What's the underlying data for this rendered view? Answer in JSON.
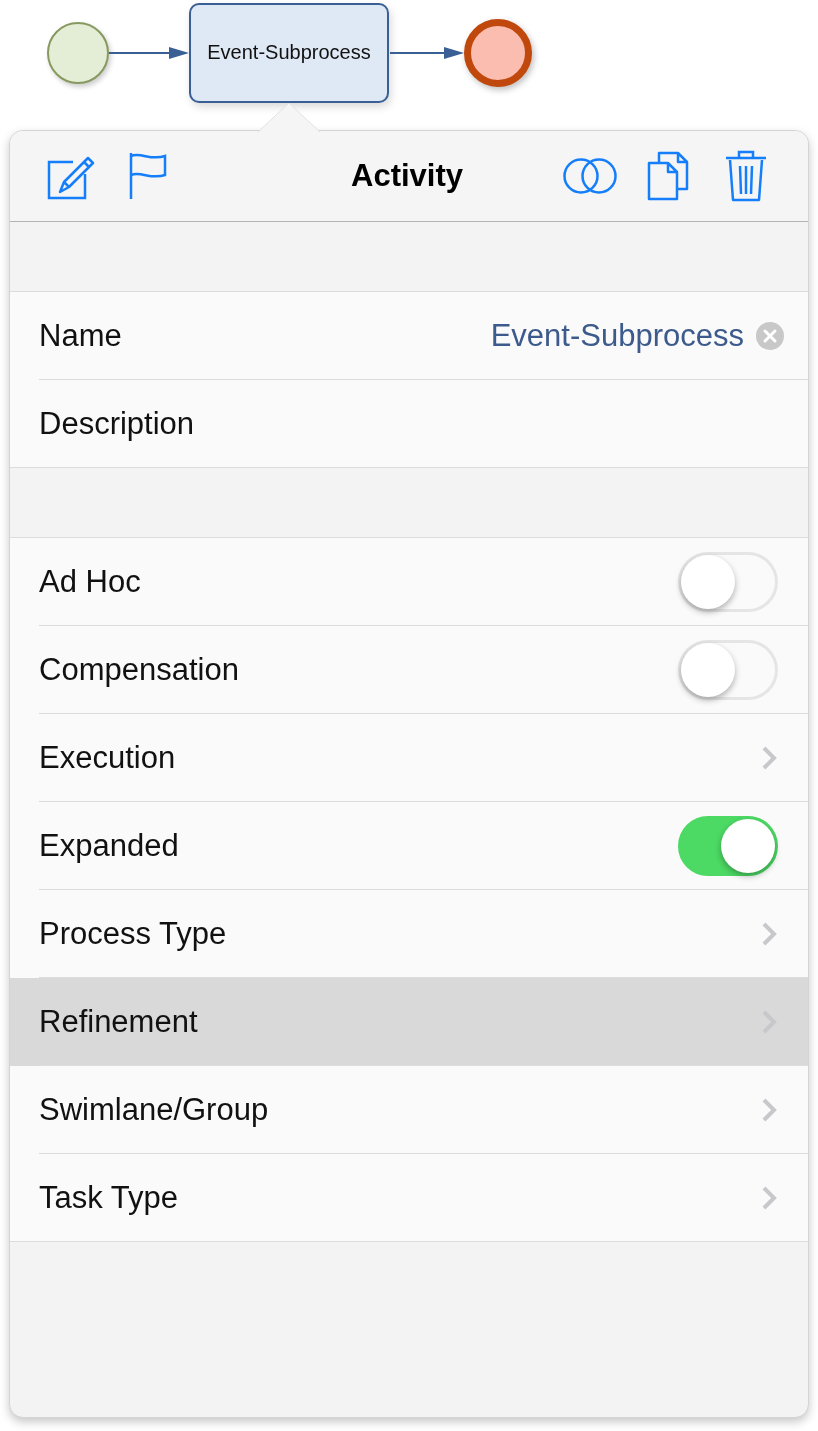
{
  "diagram": {
    "task": {
      "label": "Event-Subprocess"
    }
  },
  "popover": {
    "title": "Activity"
  },
  "sections": [
    {
      "rows": [
        {
          "kind": "field",
          "label": "Name",
          "value": "Event-Subprocess",
          "selected": false
        },
        {
          "kind": "field",
          "label": "Description",
          "selected": false
        }
      ]
    },
    {
      "rows": [
        {
          "kind": "toggle",
          "label": "Ad Hoc",
          "on": false,
          "selected": false
        },
        {
          "kind": "toggle",
          "label": "Compensation",
          "on": false,
          "selected": false
        },
        {
          "kind": "disclosure",
          "label": "Execution",
          "selected": false
        },
        {
          "kind": "toggle",
          "label": "Expanded",
          "on": true,
          "selected": false
        },
        {
          "kind": "disclosure",
          "label": "Process Type",
          "selected": false
        },
        {
          "kind": "disclosure",
          "label": "Refinement",
          "selected": true
        },
        {
          "kind": "disclosure",
          "label": "Swimlane/Group",
          "selected": false
        },
        {
          "kind": "disclosure",
          "label": "Task Type",
          "selected": false
        }
      ]
    }
  ]
}
